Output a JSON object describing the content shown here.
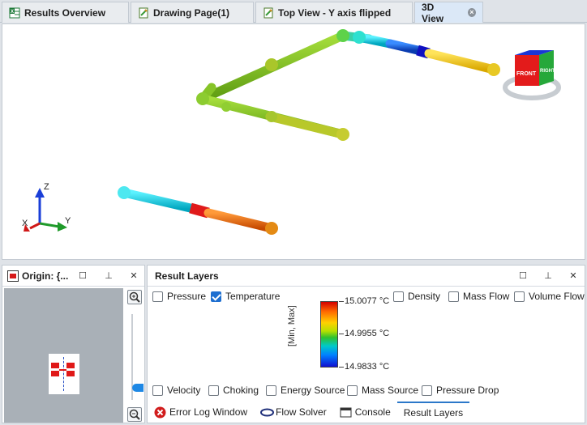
{
  "tabs": [
    {
      "label": "Results Overview",
      "icon": "spreadsheet-icon"
    },
    {
      "label": "Drawing Page(1)",
      "icon": "drawing-page-icon"
    },
    {
      "label": "Top View - Y axis flipped",
      "icon": "drawing-page-icon"
    },
    {
      "label": "3D View",
      "icon": "close-icon",
      "active": true
    }
  ],
  "viewport": {
    "axes": {
      "z": "Z",
      "x": "X",
      "y": "Y"
    },
    "view_cube": {
      "front": "FRONT",
      "right": "RIGHT"
    }
  },
  "origin_panel": {
    "title": "Origin: {...",
    "buttons": [
      "maximize-icon",
      "pin-icon",
      "close-icon"
    ]
  },
  "result_layers": {
    "title": "Result Layers",
    "checkboxes_top": [
      {
        "label": "Pressure",
        "checked": false
      },
      {
        "label": "Temperature",
        "checked": true
      },
      {
        "label": "Density",
        "checked": false
      },
      {
        "label": "Mass Flow",
        "checked": false
      },
      {
        "label": "Volume Flow",
        "checked": false
      }
    ],
    "checkboxes_bottom": [
      {
        "label": "Velocity",
        "checked": false
      },
      {
        "label": "Choking",
        "checked": false
      },
      {
        "label": "Energy Source",
        "checked": false
      },
      {
        "label": "Mass Source",
        "checked": false
      },
      {
        "label": "Pressure Drop",
        "checked": false
      }
    ],
    "legend": {
      "axis_label": "[Min, Max]",
      "max": "15.0077 °C",
      "mid": "14.9955 °C",
      "min": "14.9833 °C"
    }
  },
  "bottom_tabs": [
    {
      "label": "Error Log Window",
      "icon": "error-icon"
    },
    {
      "label": "Flow Solver",
      "icon": "flow-solver-icon"
    },
    {
      "label": "Console",
      "icon": "console-icon"
    },
    {
      "label": "Result Layers",
      "icon": "",
      "active": true
    }
  ],
  "colors": {
    "accent": "#2b78c9",
    "pipe_cyan": "#00d6e6",
    "pipe_red": "#e02020",
    "pipe_orange": "#f06a10",
    "pipe_yellow": "#d6d63a",
    "pipe_green": "#7fc21c",
    "pipe_blue": "#1a5fe0"
  }
}
